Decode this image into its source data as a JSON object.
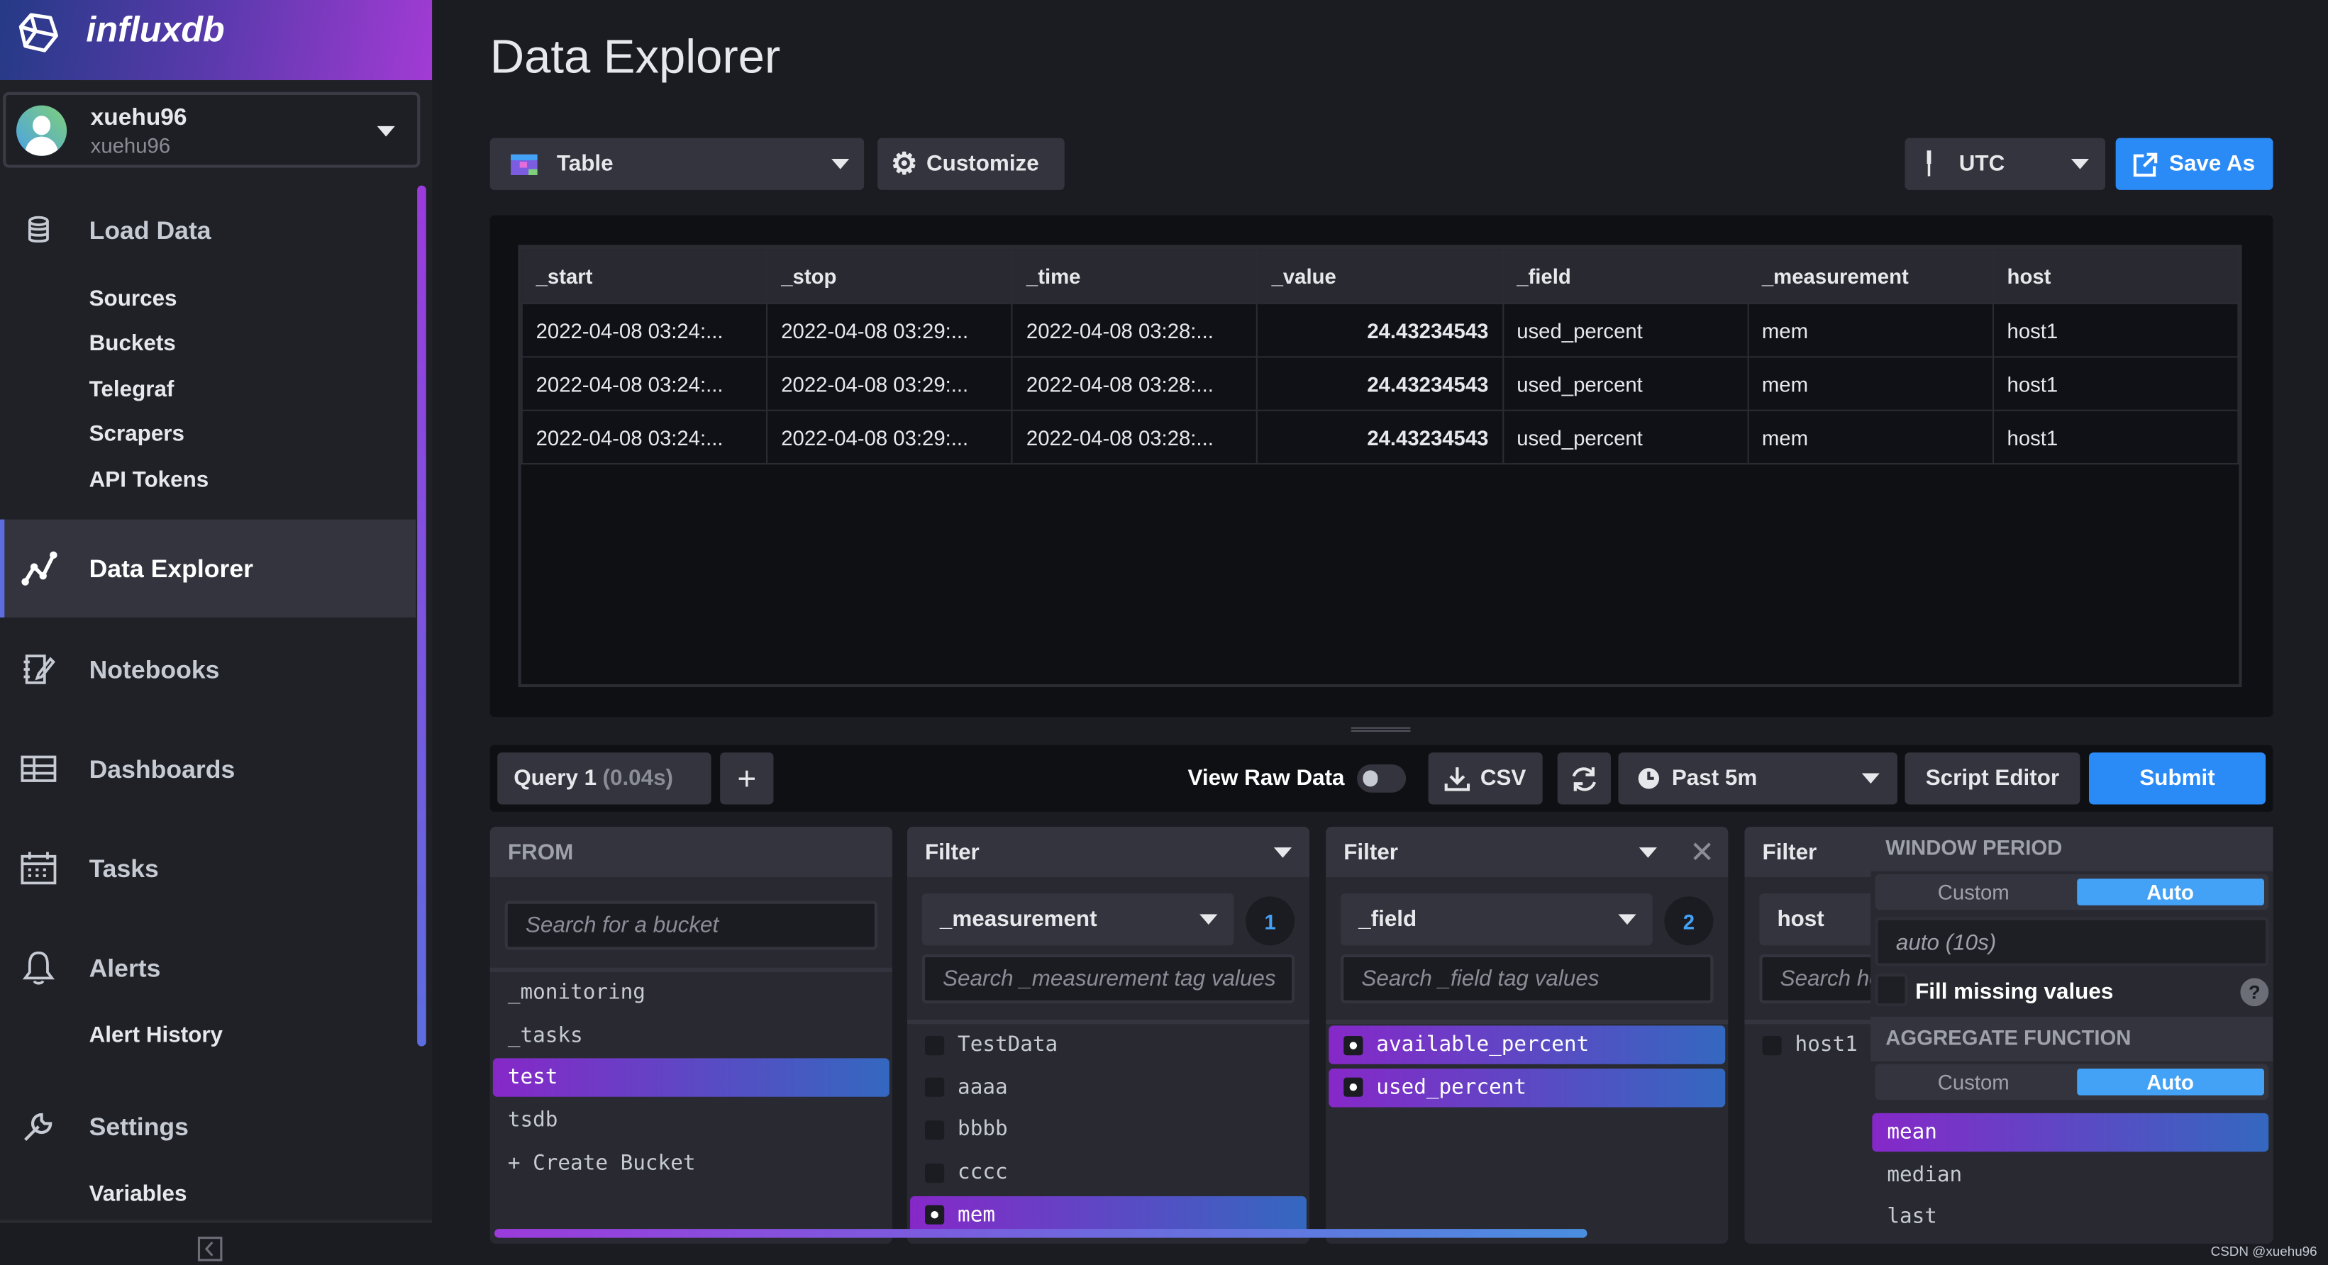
{
  "app": {
    "brand": "influxdb",
    "colors": {
      "accent": "#44a2f6",
      "primary_button": "#2a8af6",
      "selected_gradient": [
        "#8628c8",
        "#3468c0"
      ]
    }
  },
  "user": {
    "name": "xuehu96",
    "org": "xuehu96"
  },
  "sidebar": {
    "items": [
      {
        "label": "Load Data",
        "icon": "database-icon",
        "sub": [
          "Sources",
          "Buckets",
          "Telegraf",
          "Scrapers",
          "API Tokens"
        ]
      },
      {
        "label": "Data Explorer",
        "icon": "graph-line-icon",
        "active": true
      },
      {
        "label": "Notebooks",
        "icon": "notebook-icon"
      },
      {
        "label": "Dashboards",
        "icon": "dashboard-grid-icon"
      },
      {
        "label": "Tasks",
        "icon": "calendar-icon"
      },
      {
        "label": "Alerts",
        "icon": "bell-icon",
        "sub": [
          "Alert History"
        ]
      },
      {
        "label": "Settings",
        "icon": "wrench-icon",
        "sub": [
          "Variables"
        ]
      }
    ]
  },
  "header": {
    "title": "Data Explorer"
  },
  "toolbar": {
    "visualization": "Table",
    "customize": "Customize",
    "timezone": "UTC",
    "save_as": "Save As"
  },
  "table": {
    "columns": [
      "_start",
      "_stop",
      "_time",
      "_value",
      "_field",
      "_measurement",
      "host"
    ],
    "rows": [
      [
        "2022-04-08 03:24:...",
        "2022-04-08 03:29:...",
        "2022-04-08 03:28:...",
        "24.43234543",
        "used_percent",
        "mem",
        "host1"
      ],
      [
        "2022-04-08 03:24:...",
        "2022-04-08 03:29:...",
        "2022-04-08 03:28:...",
        "24.43234543",
        "used_percent",
        "mem",
        "host1"
      ],
      [
        "2022-04-08 03:24:...",
        "2022-04-08 03:29:...",
        "2022-04-08 03:28:...",
        "24.43234543",
        "used_percent",
        "mem",
        "host1"
      ]
    ]
  },
  "query_bar": {
    "tab": "Query 1",
    "timing": "(0.04s)",
    "add": "+",
    "view_raw": "View Raw Data",
    "view_raw_on": false,
    "csv": "CSV",
    "range": "Past 5m",
    "script_editor": "Script Editor",
    "submit": "Submit"
  },
  "builder": {
    "from": {
      "title": "FROM",
      "placeholder": "Search for a bucket",
      "buckets": [
        "_monitoring",
        "_tasks",
        "test",
        "tsdb"
      ],
      "selected": "test",
      "create": "+ Create Bucket"
    },
    "filters": [
      {
        "title": "Filter",
        "key": "_measurement",
        "count": "1",
        "placeholder": "Search _measurement tag values",
        "values": [
          "TestData",
          "aaaa",
          "bbbb",
          "cccc",
          "mem"
        ],
        "selected": [
          "mem"
        ]
      },
      {
        "title": "Filter",
        "key": "_field",
        "count": "2",
        "placeholder": "Search _field tag values",
        "values": [
          "available_percent",
          "used_percent"
        ],
        "selected": [
          "available_percent",
          "used_percent"
        ]
      },
      {
        "title": "Filter",
        "key": "host",
        "placeholder": "Search host tag values",
        "values": [
          "host1"
        ],
        "selected": []
      }
    ],
    "aggregate": {
      "window_title": "WINDOW PERIOD",
      "custom": "Custom",
      "auto": "Auto",
      "window_value": "auto (10s)",
      "fill_missing": "Fill missing values",
      "fill_checked": false,
      "agg_title": "AGGREGATE FUNCTION",
      "functions": [
        "mean",
        "median",
        "last"
      ],
      "selected": "mean"
    }
  },
  "watermark": "CSDN @xuehu96"
}
